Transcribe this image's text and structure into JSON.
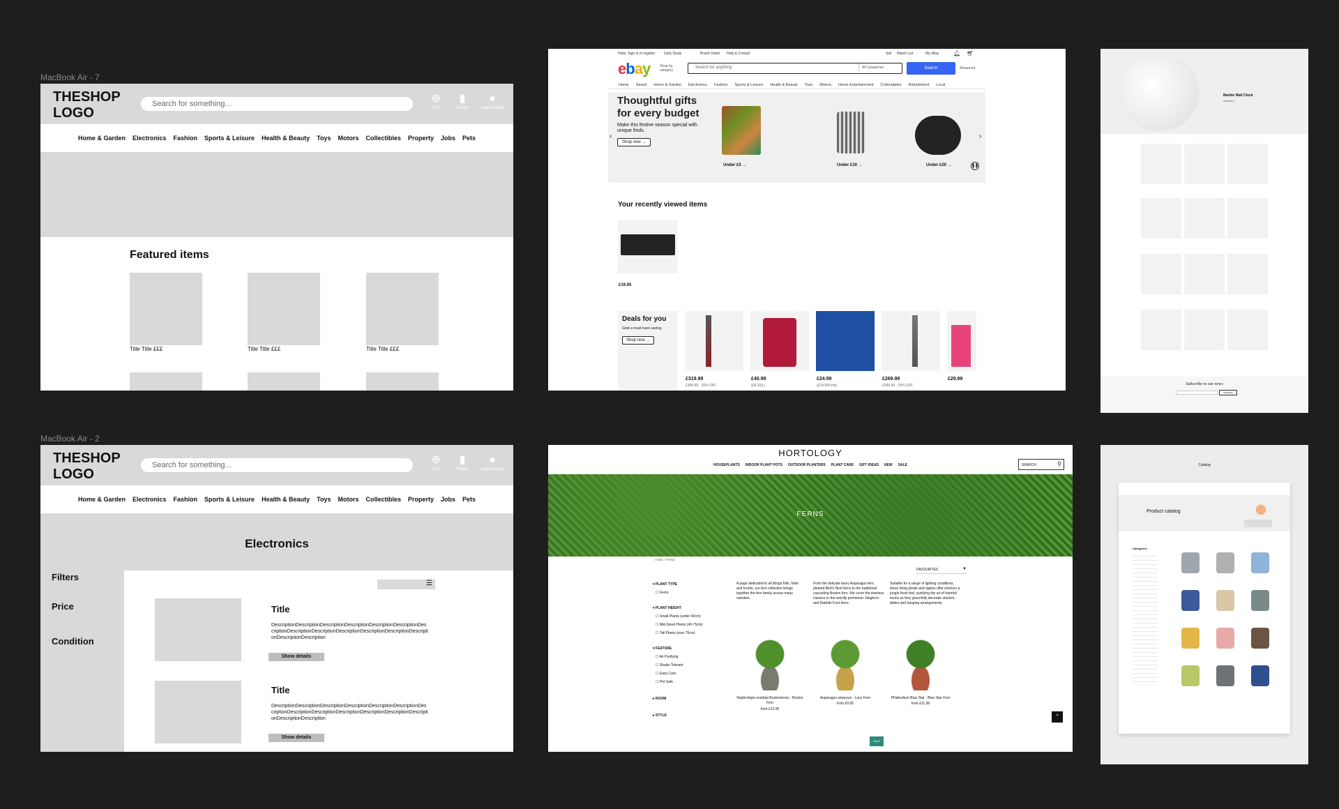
{
  "frames": {
    "top_left_label": "MacBook Air - 7",
    "bottom_left_label": "MacBook Air - 2"
  },
  "wireframe_home": {
    "logo": "THESHOP LOGO",
    "search_placeholder": "Search for something...",
    "icons": [
      {
        "icon": "plus-icon",
        "label": "Sell"
      },
      {
        "icon": "bookmark-icon",
        "label": "Saved"
      },
      {
        "icon": "user-icon",
        "label": "Login/register"
      }
    ],
    "nav": [
      "Home & Garden",
      "Electronics",
      "Fashion",
      "Sports & Leisure",
      "Health & Beauty",
      "Toys",
      "Motors",
      "Collectibles",
      "Property",
      "Jobs",
      "Pets"
    ],
    "featured_heading": "Featured items",
    "card_title": "Title Title £££"
  },
  "wireframe_electronics": {
    "logo": "THESHOP LOGO",
    "search_placeholder": "Search for something...",
    "page_title": "Electronics",
    "filters": [
      "Filters",
      "Price",
      "Condition"
    ],
    "results": [
      {
        "title": "Title",
        "description": "DescriptionDescriptionDescriptionDescriptionDescriptionDescriptionDescriptionDescriptionDescriptionDescriptionDescriptionDescriptionDescriptionDescriptionDescription",
        "button": "Show details"
      },
      {
        "title": "Title",
        "description": "DescriptionDescriptionDescriptionDescriptionDescriptionDescriptionDescriptionDescriptionDescriptionDescriptionDescriptionDescriptionDescriptionDescriptionDescription",
        "button": "Show details"
      }
    ]
  },
  "ebay": {
    "top_links": [
      "Hello, Sign in or register",
      "Sell",
      "Watch List",
      "My eBay",
      "Daily Deals",
      "Brand Outlet",
      "Help & Contact"
    ],
    "logo": "ebay",
    "shop_by": "Shop by category",
    "search_placeholder": "Search for anything",
    "category_select": "All Categories",
    "search_button": "Search",
    "advanced": "Advanced",
    "nav": [
      "Home",
      "Saved",
      "Home & Garden",
      "Electronics",
      "Fashion",
      "Sports & Leisure",
      "Health & Beauty",
      "Toys",
      "Motors",
      "Home Entertainment",
      "Collectables",
      "Refurbished",
      "Local"
    ],
    "banner_title": "Thoughtful gifts for every budget",
    "banner_sub": "Make this festive season special with unique finds.",
    "banner_cta": "Shop now",
    "tiers": [
      "Under £5",
      "Under £10",
      "Under £20"
    ],
    "recent_heading": "Your recently viewed items",
    "recent_price": "£19.95",
    "deals_heading": "Deals for you",
    "deals_sub": "Grab a must-have saving.",
    "deals_cta": "Shop now",
    "deal_prices": [
      "£319.99",
      "£40.99",
      "£24.99",
      "£269.99",
      "£29.89"
    ],
    "deal_notes": [
      "£399.99 · 20% OFF",
      "(£8.20/L)",
      "(£24.99/Unit)",
      "£399.99 · 33% OFF",
      ""
    ]
  },
  "hortology": {
    "logo": "HORTOLOGY",
    "nav": [
      "HOUSEPLANTS",
      "INDOOR PLANT POTS",
      "OUTDOOR PLANTERS",
      "PLANT CARE",
      "GIFT IDEAS",
      "NEW",
      "SALE"
    ],
    "search_placeholder": "SEARCH",
    "hero": "FERNS",
    "breadcrumb": "HOME / FERNS",
    "sort": "FAVOURITES",
    "filters": {
      "plant_type": "PLANT TYPE",
      "plant_type_opts": [
        "Ferns"
      ],
      "plant_height": "PLANT HEIGHT",
      "plant_height_opts": [
        "Small Plants (under 40cm)",
        "Mid-Sized Plants (40-75cm)",
        "Tall Plants (over 75cm)"
      ],
      "feature": "FEATURE",
      "feature_opts": [
        "Air Purifying",
        "Shade Tolerant",
        "Easy Care",
        "Pet Safe"
      ],
      "room": "ROOM",
      "style": "STYLE"
    },
    "intro": [
      "A page dedicated to all things frills, folds and fronds, our fern collection brings together the fern family across many varieties.",
      "From the delicate lacey Asparagus fern, pleated Bird's Nest ferns to the traditional cascading Boston fern. We cover the timeless classics to the weirdly prehistoric Staghorn and Rabbits Foot ferns.",
      "Suitable for a range of lighting conditions, these living pleats and ripples offer interiors a jungle fresh feel, purifying the air of harmful toxins as they gracefully decorate shelves, tables and hanging arrangements."
    ],
    "products": [
      {
        "name": "Nephrolepis exaltata Bostoniensis - Boston Fern",
        "price": "from £12.95"
      },
      {
        "name": "Asparagus setaceus - Lace Fern",
        "price": "from £9.95"
      },
      {
        "name": "Phlebodium Blue Star - Blue Star Fern",
        "price": "from £11.99"
      }
    ],
    "sale_badge": "SALE"
  },
  "clock_store": {
    "hero_title": "Marble Wall Clock",
    "hero_sub": "Mataano",
    "subscribe": "Subscribe to our news",
    "subscribe_btn": "Subscribe"
  },
  "catalog": {
    "header": "Catalog",
    "title": "Product catalog",
    "categories_label": "Categories"
  }
}
